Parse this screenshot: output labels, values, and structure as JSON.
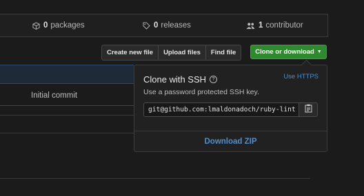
{
  "stats": [
    {
      "count": "0",
      "label": "packages",
      "icon": "package-icon"
    },
    {
      "count": "0",
      "label": "releases",
      "icon": "tag-icon"
    },
    {
      "count": "1",
      "label": "contributor",
      "icon": "people-icon"
    }
  ],
  "toolbar": {
    "create_new_file": "Create new file",
    "upload_files": "Upload files",
    "find_file": "Find file",
    "clone_or_download": "Clone or download"
  },
  "files": {
    "commit_message": "Initial commit"
  },
  "clone_popup": {
    "title": "Clone with SSH",
    "use_https": "Use HTTPS",
    "description": "Use a password protected SSH key.",
    "url": "git@github.com:lmaldonadoch/ruby-lint",
    "download_zip": "Download ZIP"
  },
  "colors": {
    "primary_button": "#2f8a2f",
    "link": "#4f8fcf",
    "background": "#1b1b1b"
  }
}
